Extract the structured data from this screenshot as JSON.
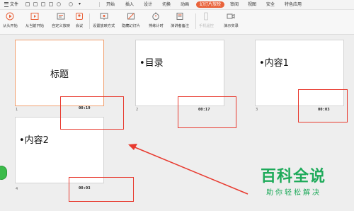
{
  "menu": {
    "file_label": "文件",
    "tabs": [
      "开始",
      "插入",
      "设计",
      "切换",
      "动画",
      "幻灯片放映",
      "审阅",
      "视图",
      "安全",
      "特色应用"
    ],
    "active_tab": "幻灯片放映"
  },
  "ribbon": {
    "buttons": [
      "从头开始",
      "从当前开始",
      "自定义放映",
      "会议",
      "设置放映方式",
      "隐藏幻灯片",
      "排练计时",
      "演讲者备注",
      "手机遥控",
      "演示实录"
    ]
  },
  "slides": [
    {
      "number": "1",
      "text": "标题",
      "timing": "00:19"
    },
    {
      "number": "2",
      "text": "•目录",
      "timing": "00:17"
    },
    {
      "number": "3",
      "text": "•内容1",
      "timing": "00:03"
    },
    {
      "number": "4",
      "text": "•内容2",
      "timing": "00:03"
    }
  ],
  "watermark": {
    "main": "百科全说",
    "sub": "助你轻松解决"
  },
  "colors": {
    "accent": "#e9633b",
    "highlight": "#e83a2f",
    "brand_green": "#1eaa5a"
  }
}
